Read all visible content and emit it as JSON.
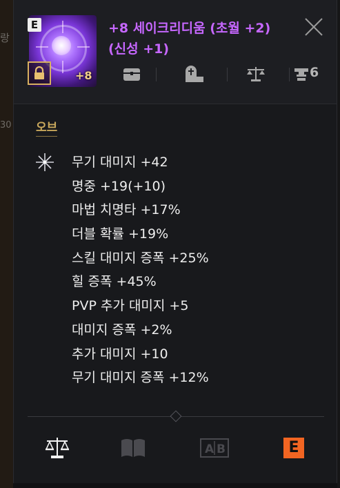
{
  "background": {
    "left_fragment_top": "랑",
    "left_fragment_mid": "30"
  },
  "item": {
    "grade_badge": "E",
    "enchant_level": "+8",
    "name": "+8 세이크리디움 (초월 +2) (신성 +1)",
    "name_color": "#c667ff",
    "icon_row": {
      "icons": [
        "chest-icon",
        "tombstone-icon",
        "scale-icon",
        "anvil-icon"
      ],
      "count": "6"
    }
  },
  "section": {
    "title": "오브",
    "stats": [
      "무기 대미지 +42",
      "명중 +19(+10)",
      "마법 치명타 +17%",
      "더블 확률 +19%",
      "스킬 대미지 증폭 +25%",
      "힐 증폭 +45%",
      "PVP 추가 대미지 +5",
      "대미지 증폭 +2%",
      "추가 대미지 +10",
      "무기 대미지 증폭 +12%"
    ]
  },
  "bottom_tabs": {
    "tabs": [
      "scale-icon",
      "book-icon",
      "ab-icon",
      "e-grade-icon"
    ],
    "e_label": "E",
    "e_color": "#f26522"
  }
}
